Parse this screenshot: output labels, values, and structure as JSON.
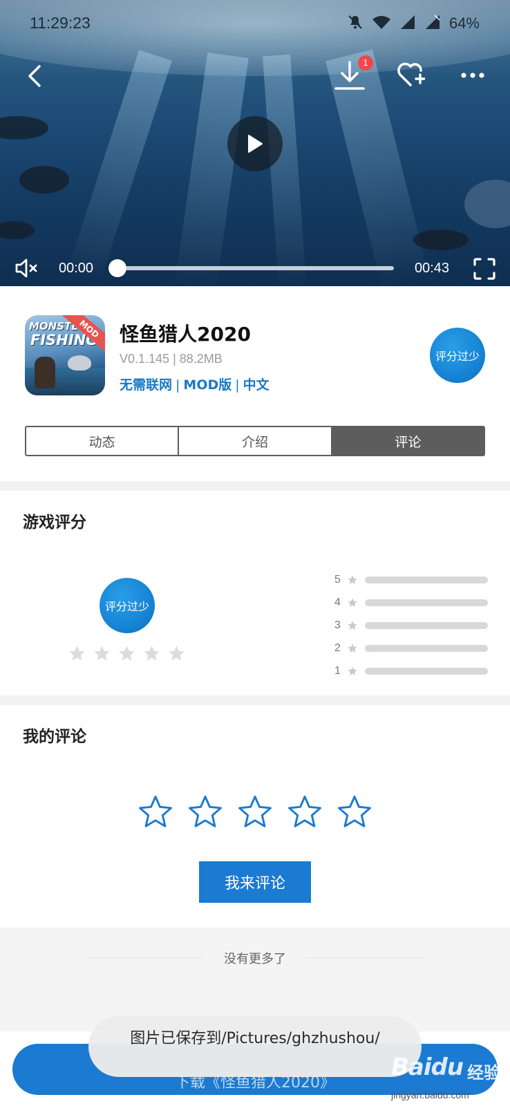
{
  "status_bar": {
    "time": "11:29:23",
    "battery": "64%",
    "icons": [
      "bell-muted-icon",
      "wifi-icon",
      "signal-icon",
      "signal-icon"
    ]
  },
  "player": {
    "current_time": "00:00",
    "duration": "00:43",
    "progress_fraction": 0.0,
    "download_badge": "1",
    "icons": [
      "back-icon",
      "download-icon",
      "favorite-add-icon",
      "more-icon",
      "play-icon",
      "mute-icon",
      "fullscreen-icon"
    ]
  },
  "app": {
    "title": "怪鱼猎人2020",
    "version": "V0.1.145",
    "size": "88.2MB",
    "meta_separator": "|",
    "tags": [
      "无需联网",
      "MOD版",
      "中文"
    ],
    "score_label": "评分过少",
    "icon_text": {
      "line1": "MONSTER",
      "line2": "FISHING",
      "ribbon": "MOD"
    }
  },
  "tabs": [
    {
      "label": "动态",
      "active": false
    },
    {
      "label": "介绍",
      "active": false
    },
    {
      "label": "评论",
      "active": true
    }
  ],
  "game_rating": {
    "title": "游戏评分",
    "score_label": "评分过少",
    "star_count": 5,
    "breakdown": [
      {
        "stars": "5",
        "fraction": 0
      },
      {
        "stars": "4",
        "fraction": 0
      },
      {
        "stars": "3",
        "fraction": 0
      },
      {
        "stars": "2",
        "fraction": 0
      },
      {
        "stars": "1",
        "fraction": 0
      }
    ]
  },
  "my_comment": {
    "title": "我的评论",
    "star_count": 5,
    "button_label": "我来评论"
  },
  "footer": {
    "no_more": "没有更多了"
  },
  "bottom": {
    "download_label": "下载《怪鱼猎人2020》",
    "toast": "图片已保存到/Pictures/ghzhushou/"
  },
  "watermark": {
    "brand": "Baidu",
    "brand_cn": "经验",
    "url": "jingyan.baidu.com"
  },
  "colors": {
    "accent": "#1b7ad1",
    "tag_blue": "#1a79c6",
    "tab_active": "#5d5d5d",
    "badge_red": "#f0474b"
  }
}
